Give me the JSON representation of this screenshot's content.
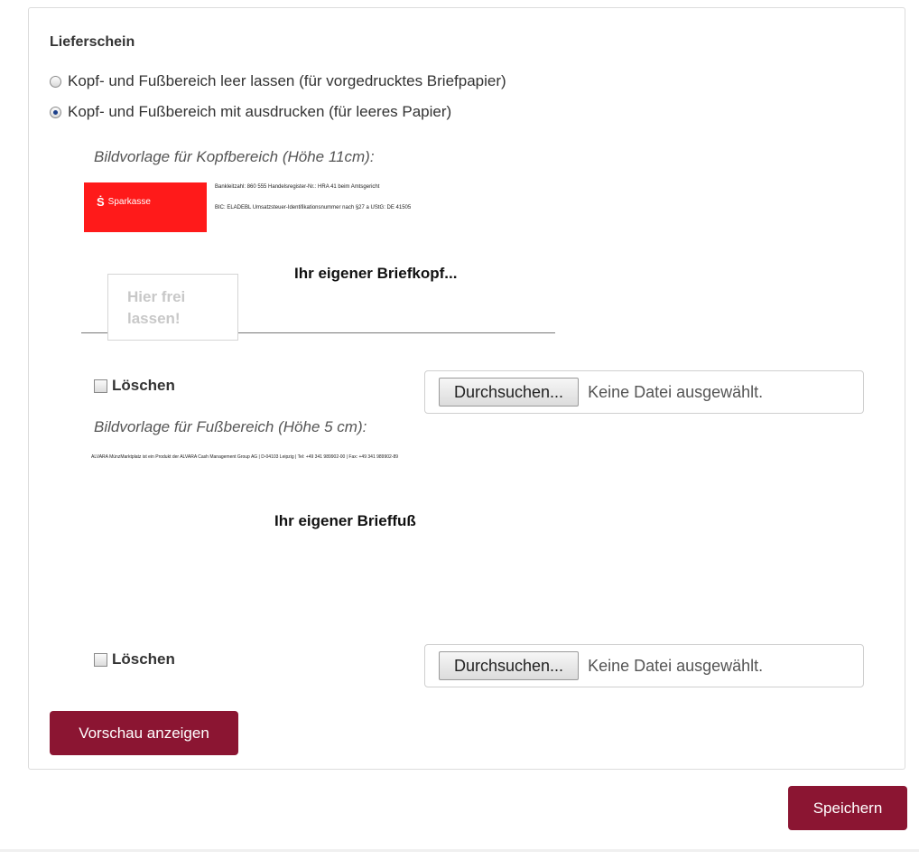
{
  "section": {
    "title": "Lieferschein",
    "options": [
      {
        "label": "Kopf- und Fußbereich leer lassen (für vorgedrucktes Briefpapier)",
        "checked": false
      },
      {
        "label": "Kopf- und Fußbereich mit ausdrucken (für leeres Papier)",
        "checked": true
      }
    ]
  },
  "header_template": {
    "caption": "Bildvorlage für Kopfbereich (Höhe 11cm):",
    "logo_text": "Sparkasse",
    "info_line_1": "Bankleitzahl: 860 555 Handelsregister-Nr.: HRA 41 beim Amtsgericht",
    "info_line_2": "BIC: ELADEBL Umsatzsteuer-Identifikationsnummer nach §27 a UStG: DE 41505",
    "heading": "Ihr eigener Briefkopf...",
    "free_note": "Hier frei lassen!",
    "delete_label": "Löschen",
    "browse_label": "Durchsuchen...",
    "no_file_label": "Keine Datei ausgewählt."
  },
  "footer_template": {
    "caption": "Bildvorlage für Fußbereich (Höhe 5 cm):",
    "footer_line": "ALVARA MünzMarktplatz ist ein Produkt der ALVARA Cash Management Group AG | D-04103 Leipzig | Tel: +49 341 989902-00 | Fax: +49 341 989902-89",
    "heading": "Ihr eigener Brieffuß",
    "delete_label": "Löschen",
    "browse_label": "Durchsuchen...",
    "no_file_label": "Keine Datei ausgewählt."
  },
  "actions": {
    "preview_label": "Vorschau anzeigen",
    "save_label": "Speichern"
  },
  "colors": {
    "accent": "#8b1532",
    "brand_red": "#ff1a1a"
  }
}
